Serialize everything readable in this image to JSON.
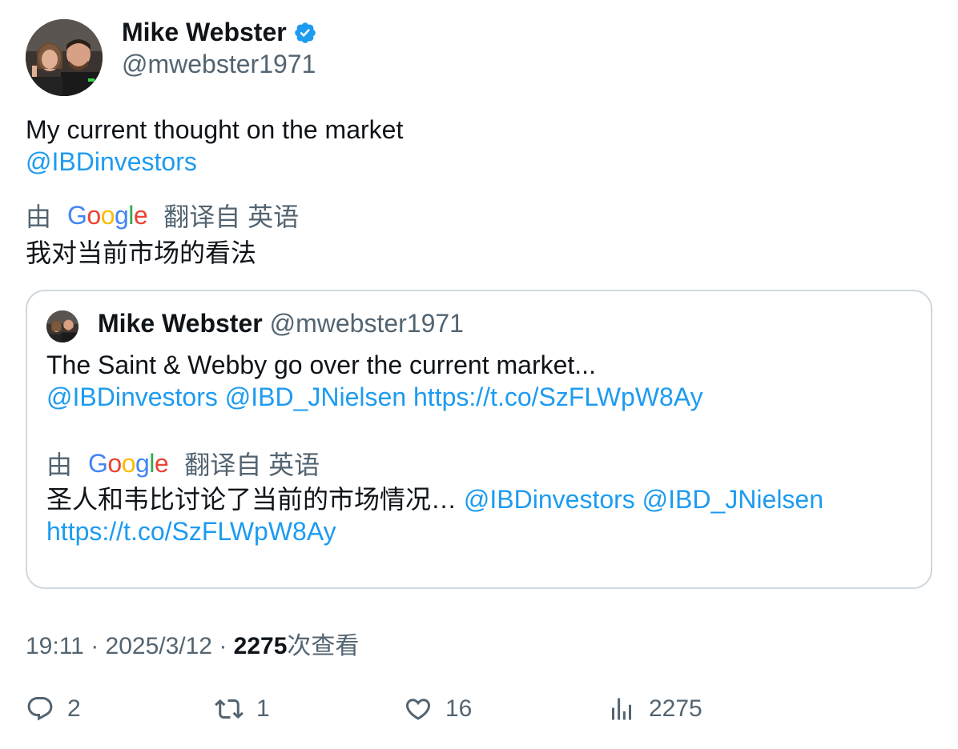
{
  "author": {
    "display_name": "Mike Webster",
    "handle": "@mwebster1971",
    "verified": true
  },
  "tweet": {
    "text": "My current thought on the market",
    "mention": "@IBDinvestors",
    "translation_prefix": "由",
    "translation_brand": "Google",
    "translation_suffix": "翻译自 英语",
    "translated_text": "我对当前市场的看法"
  },
  "quote": {
    "display_name": "Mike Webster",
    "handle": "@mwebster1971",
    "text": "The Saint & Webby go over the current market...",
    "mention1": "@IBDinvestors",
    "mention2": "@IBD_JNielsen",
    "url": "https://t.co/SzFLWpW8Ay",
    "translation_prefix": "由",
    "translation_brand": "Google",
    "translation_suffix": "翻译自 英语",
    "translated_text": "圣人和韦比讨论了当前的市场情况…",
    "translated_mention1": "@IBDinvestors",
    "translated_mention2": "@IBD_JNielsen",
    "translated_url": "https://t.co/SzFLWpW8Ay"
  },
  "meta": {
    "time": "19:11",
    "sep1": " · ",
    "date": "2025/3/12",
    "sep2": " · ",
    "views": "2275",
    "views_label": "次查看"
  },
  "actions": {
    "replies": "2",
    "reposts": "1",
    "likes": "16",
    "views": "2275"
  },
  "colors": {
    "link": "#1d9bf0",
    "secondary": "#536471",
    "border": "#cfd9de"
  },
  "icons": [
    "verified-badge-icon",
    "reply-icon",
    "repost-icon",
    "like-icon",
    "views-icon",
    "google-logo"
  ]
}
